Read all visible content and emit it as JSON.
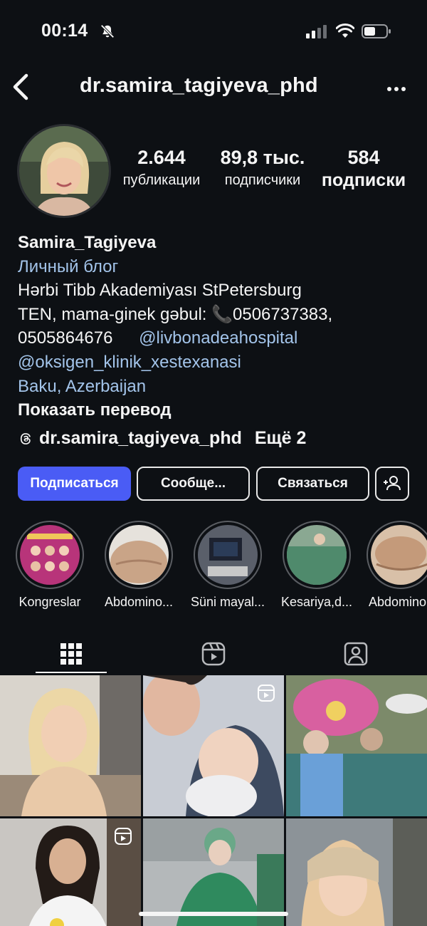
{
  "status_bar": {
    "time": "00:14"
  },
  "header": {
    "username": "dr.samira_tagiyeva_phd"
  },
  "stats": {
    "posts": {
      "value": "2.644",
      "label": "публикации"
    },
    "followers": {
      "value": "89,8 тыс.",
      "label": "подписчики"
    },
    "following": {
      "value": "584",
      "label": "подписки"
    }
  },
  "bio": {
    "name": "Samira_Tagiyeva",
    "category": "Личный блог",
    "line1": "Hərbi Tibb Akademiyası  StPetersburg",
    "line2": "TEN, mama-ginek gəbul: 📞0506737383,",
    "line3_phone": "0505864676",
    "line3_mention": "@livbonadeahospital",
    "line4_mention": "@oksigen_klinik_xestexanasi",
    "location": "Baku, Azerbaijan",
    "translate": "Показать перевод",
    "threads_handle": "dr.samira_tagiyeva_phd",
    "more_links": "Ещё 2"
  },
  "buttons": {
    "follow": "Подписаться",
    "message": "Сообще...",
    "contact": "Связаться"
  },
  "highlights": [
    {
      "label": "Kongreslar"
    },
    {
      "label": "Abdomino..."
    },
    {
      "label": "Süni mayal..."
    },
    {
      "label": "Kesariya,d..."
    },
    {
      "label": "Abdomino"
    }
  ],
  "tabs": [
    "grid",
    "reels",
    "tagged"
  ],
  "colors": {
    "background": "#0d1014",
    "accent_button": "#4a5cf5",
    "link": "#a3c4ea"
  },
  "icons": [
    "bell-off-icon",
    "signal-icon",
    "wifi-icon",
    "battery-icon",
    "back-chevron-icon",
    "more-dots-icon",
    "threads-icon",
    "add-user-icon",
    "grid-icon",
    "reels-icon",
    "tagged-icon"
  ]
}
